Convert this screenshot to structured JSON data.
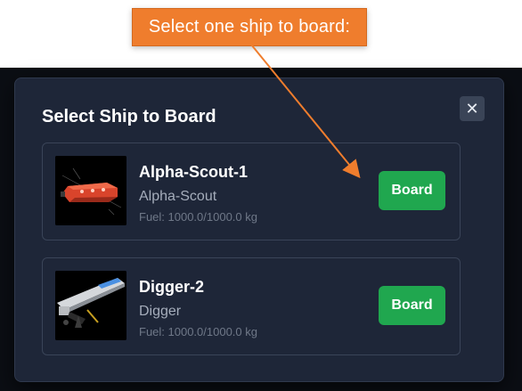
{
  "callout": {
    "text": "Select one ship to board:"
  },
  "modal": {
    "title": "Select Ship to Board",
    "close_label": "✕",
    "ships": [
      {
        "name": "Alpha-Scout-1",
        "type": "Alpha-Scout",
        "fuel": "Fuel: 1000.0/1000.0 kg",
        "board_label": "Board"
      },
      {
        "name": "Digger-2",
        "type": "Digger",
        "fuel": "Fuel: 1000.0/1000.0 kg",
        "board_label": "Board"
      }
    ]
  },
  "colors": {
    "callout_bg": "#ef7d2d",
    "modal_bg": "#1e2638",
    "board_button": "#20a74f"
  }
}
